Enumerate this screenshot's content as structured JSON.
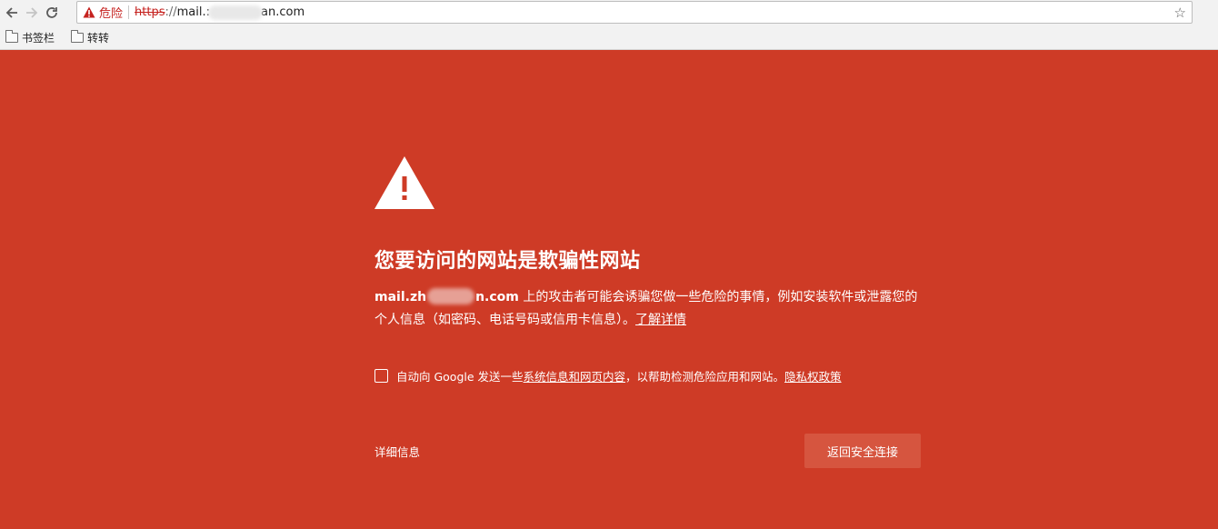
{
  "browser": {
    "url_security_label": "危险",
    "url_scheme": "https",
    "url_scheme_rest": "://",
    "url_host_start": "mail.:",
    "url_host_end": "an.com"
  },
  "bookmarks": [
    {
      "label": "书签栏"
    },
    {
      "label": "转转"
    }
  ],
  "interstitial": {
    "heading": "您要访问的网站是欺骗性网站",
    "site_start": "mail.zh",
    "site_end": "n.com",
    "desc_text": " 上的攻击者可能会诱骗您做一些危险的事情，例如安装软件或泄露您的个人信息（如密码、电话号码或信用卡信息）。",
    "learn_more": "了解详情",
    "report_prefix": "自动向 Google 发送一些",
    "report_link": "系统信息和网页内容",
    "report_mid": "，以帮助检测危险应用和网站。",
    "privacy_link": "隐私权政策",
    "details": "详细信息",
    "back_button": "返回安全连接"
  },
  "colors": {
    "danger_bg": "#ce3b26",
    "button_bg": "#d6553f"
  }
}
